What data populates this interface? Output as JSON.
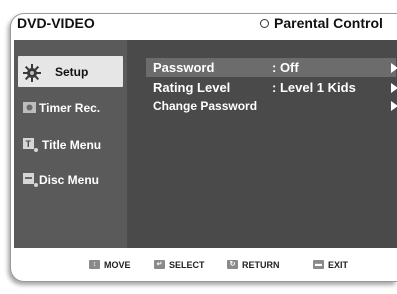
{
  "header": {
    "title": "DVD-VIDEO",
    "section": "Parental Control"
  },
  "sidebar": {
    "items": [
      {
        "label": "Setup",
        "icon": "gear-icon",
        "active": true
      },
      {
        "label": "Timer Rec.",
        "icon": "timer-icon",
        "active": false
      },
      {
        "label": "Title Menu",
        "icon": "title-menu-icon",
        "active": false
      },
      {
        "label": "Disc Menu",
        "icon": "disc-menu-icon",
        "active": false
      }
    ]
  },
  "menu": {
    "rows": [
      {
        "label": "Password",
        "value": ": Off"
      },
      {
        "label": "Rating Level",
        "value": ": Level 1 Kids"
      },
      {
        "label": "Change Password",
        "value": ""
      }
    ]
  },
  "footer": {
    "move": "MOVE",
    "select": "SELECT",
    "return": "RETURN",
    "exit": "EXIT"
  },
  "colors": {
    "panel": "#4a4a4a",
    "sidebar": "#5a5a5a",
    "selected_row": "#6c6c6c",
    "active_tab": "#e6e6e6"
  }
}
